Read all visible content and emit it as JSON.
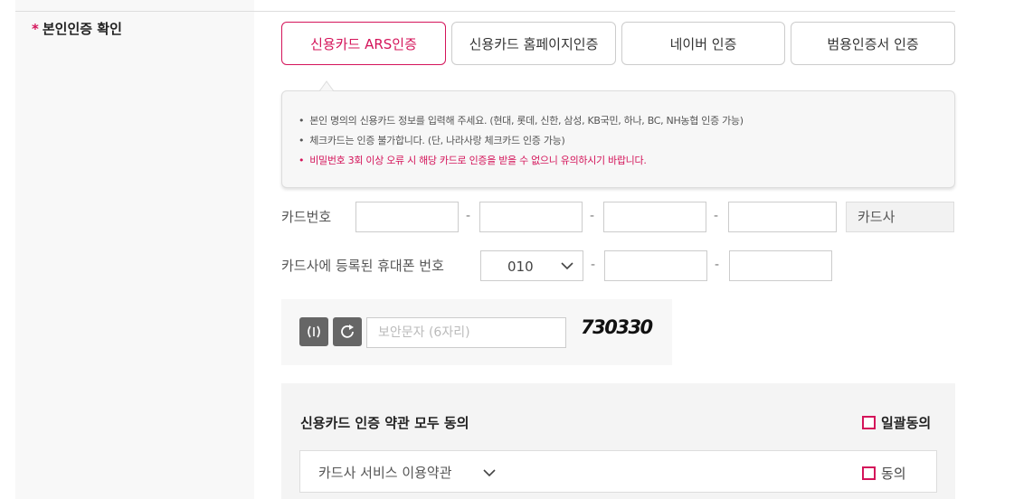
{
  "section": {
    "required_mark": "*",
    "label": "본인인증 확인"
  },
  "auth_tabs": [
    {
      "label": "신용카드 ARS인증",
      "active": true
    },
    {
      "label": "신용카드 홈페이지인증",
      "active": false
    },
    {
      "label": "네이버 인증",
      "active": false
    },
    {
      "label": "범용인증서 인증",
      "active": false
    }
  ],
  "notice": {
    "items": [
      "본인 명의의 신용카드 정보를 입력해 주세요. (현대, 롯데, 신한, 삼성, KB국민, 하나, BC, NH농협 인증 가능)",
      "체크카드는 인증 불가합니다. (단, 나라사랑 체크카드 인증 가능)",
      "비밀번호 3회 이상 오류 시 해당 카드로 인증을 받을 수 없으니 유의하시기 바랍니다."
    ]
  },
  "card_number": {
    "label": "카드번호",
    "separator": "-",
    "card_company": "카드사"
  },
  "phone": {
    "label": "카드사에 등록된 휴대폰 번호",
    "prefix_selected": "010",
    "separator": "-"
  },
  "captcha": {
    "placeholder": "보안문자 (6자리)",
    "code": "730330",
    "audio_icon": "audio-wave-icon",
    "refresh_icon": "refresh-icon"
  },
  "terms": {
    "title": "신용카드 인증 약관 모두 동의",
    "agree_all_label": "일괄동의",
    "rows": [
      {
        "label": "카드사 서비스 이용약관",
        "agree_label": "동의"
      }
    ]
  },
  "colors": {
    "accent": "#d4145a",
    "panel_bg": "#f7f7f7",
    "border": "#cccccc"
  }
}
